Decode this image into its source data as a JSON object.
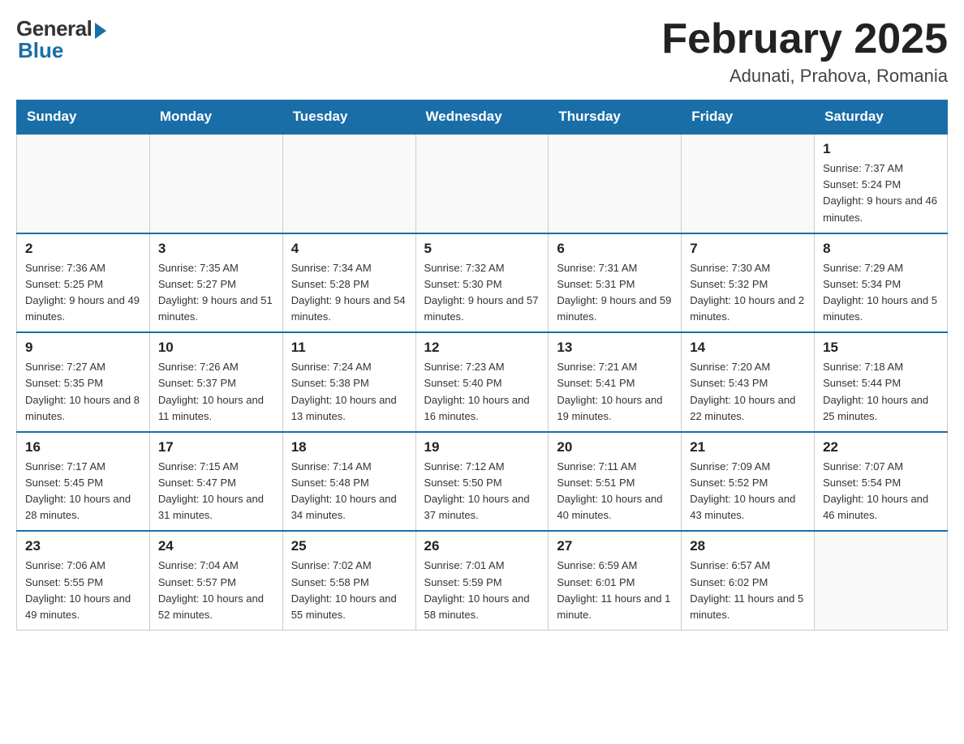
{
  "header": {
    "logo_general": "General",
    "logo_blue": "Blue",
    "month_title": "February 2025",
    "location": "Adunati, Prahova, Romania"
  },
  "days_of_week": [
    "Sunday",
    "Monday",
    "Tuesday",
    "Wednesday",
    "Thursday",
    "Friday",
    "Saturday"
  ],
  "weeks": [
    [
      {
        "day": "",
        "info": ""
      },
      {
        "day": "",
        "info": ""
      },
      {
        "day": "",
        "info": ""
      },
      {
        "day": "",
        "info": ""
      },
      {
        "day": "",
        "info": ""
      },
      {
        "day": "",
        "info": ""
      },
      {
        "day": "1",
        "info": "Sunrise: 7:37 AM\nSunset: 5:24 PM\nDaylight: 9 hours and 46 minutes."
      }
    ],
    [
      {
        "day": "2",
        "info": "Sunrise: 7:36 AM\nSunset: 5:25 PM\nDaylight: 9 hours and 49 minutes."
      },
      {
        "day": "3",
        "info": "Sunrise: 7:35 AM\nSunset: 5:27 PM\nDaylight: 9 hours and 51 minutes."
      },
      {
        "day": "4",
        "info": "Sunrise: 7:34 AM\nSunset: 5:28 PM\nDaylight: 9 hours and 54 minutes."
      },
      {
        "day": "5",
        "info": "Sunrise: 7:32 AM\nSunset: 5:30 PM\nDaylight: 9 hours and 57 minutes."
      },
      {
        "day": "6",
        "info": "Sunrise: 7:31 AM\nSunset: 5:31 PM\nDaylight: 9 hours and 59 minutes."
      },
      {
        "day": "7",
        "info": "Sunrise: 7:30 AM\nSunset: 5:32 PM\nDaylight: 10 hours and 2 minutes."
      },
      {
        "day": "8",
        "info": "Sunrise: 7:29 AM\nSunset: 5:34 PM\nDaylight: 10 hours and 5 minutes."
      }
    ],
    [
      {
        "day": "9",
        "info": "Sunrise: 7:27 AM\nSunset: 5:35 PM\nDaylight: 10 hours and 8 minutes."
      },
      {
        "day": "10",
        "info": "Sunrise: 7:26 AM\nSunset: 5:37 PM\nDaylight: 10 hours and 11 minutes."
      },
      {
        "day": "11",
        "info": "Sunrise: 7:24 AM\nSunset: 5:38 PM\nDaylight: 10 hours and 13 minutes."
      },
      {
        "day": "12",
        "info": "Sunrise: 7:23 AM\nSunset: 5:40 PM\nDaylight: 10 hours and 16 minutes."
      },
      {
        "day": "13",
        "info": "Sunrise: 7:21 AM\nSunset: 5:41 PM\nDaylight: 10 hours and 19 minutes."
      },
      {
        "day": "14",
        "info": "Sunrise: 7:20 AM\nSunset: 5:43 PM\nDaylight: 10 hours and 22 minutes."
      },
      {
        "day": "15",
        "info": "Sunrise: 7:18 AM\nSunset: 5:44 PM\nDaylight: 10 hours and 25 minutes."
      }
    ],
    [
      {
        "day": "16",
        "info": "Sunrise: 7:17 AM\nSunset: 5:45 PM\nDaylight: 10 hours and 28 minutes."
      },
      {
        "day": "17",
        "info": "Sunrise: 7:15 AM\nSunset: 5:47 PM\nDaylight: 10 hours and 31 minutes."
      },
      {
        "day": "18",
        "info": "Sunrise: 7:14 AM\nSunset: 5:48 PM\nDaylight: 10 hours and 34 minutes."
      },
      {
        "day": "19",
        "info": "Sunrise: 7:12 AM\nSunset: 5:50 PM\nDaylight: 10 hours and 37 minutes."
      },
      {
        "day": "20",
        "info": "Sunrise: 7:11 AM\nSunset: 5:51 PM\nDaylight: 10 hours and 40 minutes."
      },
      {
        "day": "21",
        "info": "Sunrise: 7:09 AM\nSunset: 5:52 PM\nDaylight: 10 hours and 43 minutes."
      },
      {
        "day": "22",
        "info": "Sunrise: 7:07 AM\nSunset: 5:54 PM\nDaylight: 10 hours and 46 minutes."
      }
    ],
    [
      {
        "day": "23",
        "info": "Sunrise: 7:06 AM\nSunset: 5:55 PM\nDaylight: 10 hours and 49 minutes."
      },
      {
        "day": "24",
        "info": "Sunrise: 7:04 AM\nSunset: 5:57 PM\nDaylight: 10 hours and 52 minutes."
      },
      {
        "day": "25",
        "info": "Sunrise: 7:02 AM\nSunset: 5:58 PM\nDaylight: 10 hours and 55 minutes."
      },
      {
        "day": "26",
        "info": "Sunrise: 7:01 AM\nSunset: 5:59 PM\nDaylight: 10 hours and 58 minutes."
      },
      {
        "day": "27",
        "info": "Sunrise: 6:59 AM\nSunset: 6:01 PM\nDaylight: 11 hours and 1 minute."
      },
      {
        "day": "28",
        "info": "Sunrise: 6:57 AM\nSunset: 6:02 PM\nDaylight: 11 hours and 5 minutes."
      },
      {
        "day": "",
        "info": ""
      }
    ]
  ]
}
